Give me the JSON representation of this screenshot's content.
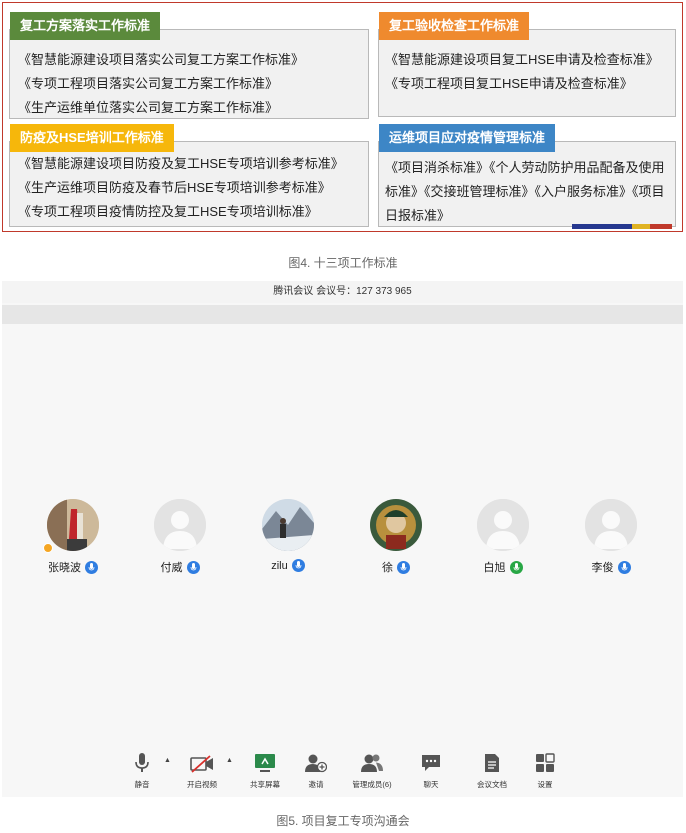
{
  "figure4": {
    "panels": [
      {
        "title": "复工方案落实工作标准",
        "items": [
          "《智慧能源建设项目落实公司复工方案工作标准》",
          "《专项工程项目落实公司复工方案工作标准》",
          "《生产运维单位落实公司复工方案工作标准》"
        ]
      },
      {
        "title": "复工验收检查工作标准",
        "items": [
          "《智慧能源建设项目复工HSE申请及检查标准》",
          "《专项工程项目复工HSE申请及检查标准》"
        ]
      },
      {
        "title": "防疫及HSE培训工作标准",
        "items": [
          "《智慧能源建设项目防疫及复工HSE专项培训参考标准》",
          "《生产运维项目防疫及春节后HSE专项培训参考标准》",
          "《专项工程项目疫情防控及复工HSE专项培训标准》"
        ]
      },
      {
        "title": "运维项目应对疫情管理标准",
        "text": "《项目消杀标准》《个人劳动防护用品配备及使用标准》《交接班管理标准》《入户服务标准》《项目日报标准》"
      }
    ],
    "colors": {
      "green": "#5b8a3c",
      "orange": "#ef8a2e",
      "yellow": "#f6b70b",
      "blue": "#3d86c6"
    },
    "caption": "图4. 十三项工作标准"
  },
  "figure5": {
    "meeting_title": "腾讯会议 会议号：127 373 965",
    "participants": [
      {
        "name": "张晓波",
        "mic": "mic-icon"
      },
      {
        "name": "付威",
        "mic": "mic-icon"
      },
      {
        "name": "zilu",
        "mic": "mic-icon"
      },
      {
        "name": "徐",
        "mic": "mic-icon"
      },
      {
        "name": "白旭",
        "mic": "mic-icon-speaking"
      },
      {
        "name": "李俊",
        "mic": "mic-icon"
      }
    ],
    "toolbar": {
      "mute": "静音",
      "video": "开启视频",
      "share": "共享屏幕",
      "invite": "邀请",
      "members": "管理成员(6)",
      "chat": "聊天",
      "docs": "会议文档",
      "settings": "设置"
    },
    "caption": "图5. 项目复工专项沟通会"
  }
}
